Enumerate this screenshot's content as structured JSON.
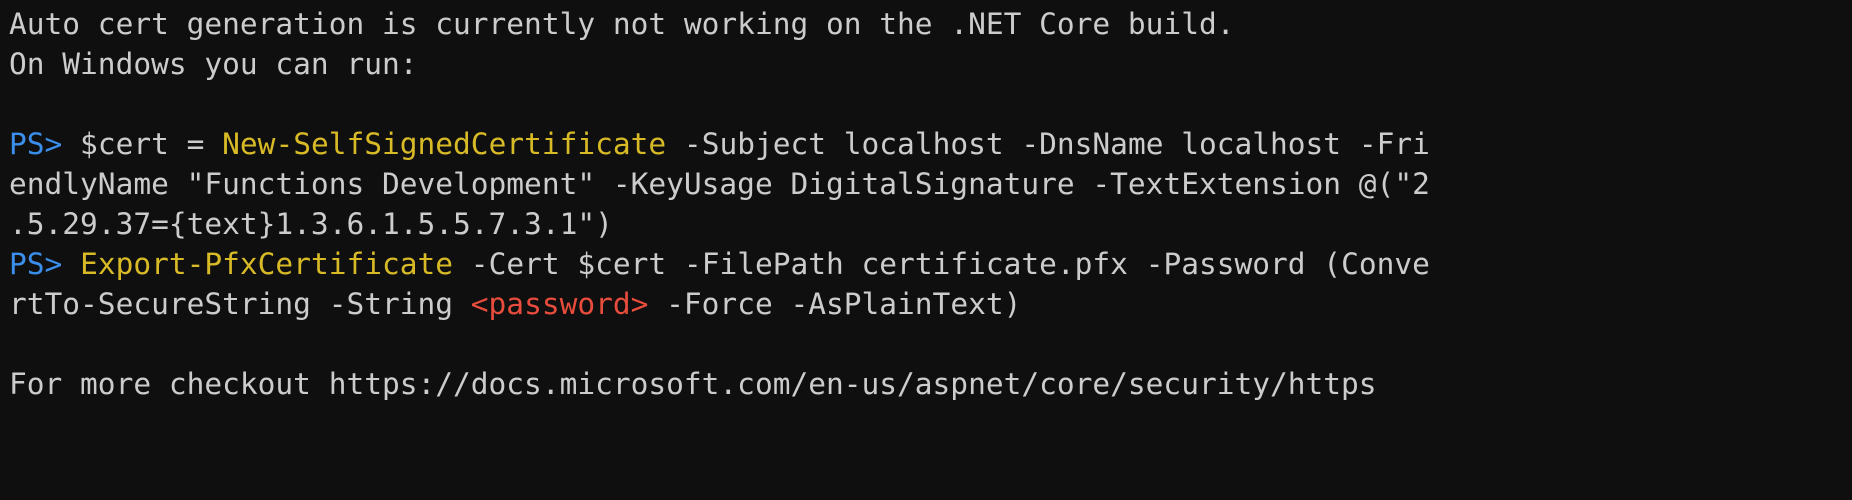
{
  "terminal": {
    "background_color": "#0f0f0f",
    "default_text_color": "#cccccc",
    "prompt_color": "#3b8eea",
    "cmdlet_color": "#d7ba26",
    "placeholder_color": "#e74c3c",
    "lines": [
      {
        "id": "line-1",
        "tokens": [
          {
            "kind": "default",
            "text": "Auto cert generation is currently not working on the .NET Core build."
          }
        ]
      },
      {
        "id": "line-2",
        "tokens": [
          {
            "kind": "default",
            "text": "On Windows you can run:"
          }
        ]
      },
      {
        "id": "line-3",
        "tokens": [
          {
            "kind": "default",
            "text": ""
          }
        ]
      },
      {
        "id": "line-4",
        "tokens": [
          {
            "kind": "prompt",
            "text": "PS>"
          },
          {
            "kind": "default",
            "text": " $cert = "
          },
          {
            "kind": "cmdlet",
            "text": "New-SelfSignedCertificate"
          },
          {
            "kind": "default",
            "text": " -Subject localhost -DnsName localhost -Fri"
          }
        ]
      },
      {
        "id": "line-5",
        "tokens": [
          {
            "kind": "default",
            "text": "endlyName \"Functions Development\" -KeyUsage DigitalSignature -TextExtension @(\"2"
          }
        ]
      },
      {
        "id": "line-6",
        "tokens": [
          {
            "kind": "default",
            "text": ".5.29.37={text}1.3.6.1.5.5.7.3.1\")"
          }
        ]
      },
      {
        "id": "line-7",
        "tokens": [
          {
            "kind": "prompt",
            "text": "PS>"
          },
          {
            "kind": "default",
            "text": " "
          },
          {
            "kind": "cmdlet",
            "text": "Export-PfxCertificate"
          },
          {
            "kind": "default",
            "text": " -Cert $cert -FilePath certificate.pfx -Password (Conve"
          }
        ]
      },
      {
        "id": "line-8",
        "tokens": [
          {
            "kind": "default",
            "text": "rtTo-SecureString -String "
          },
          {
            "kind": "placeholder",
            "text": "<password>"
          },
          {
            "kind": "default",
            "text": " -Force -AsPlainText)"
          }
        ]
      },
      {
        "id": "line-9",
        "tokens": [
          {
            "kind": "default",
            "text": ""
          }
        ]
      },
      {
        "id": "line-10",
        "tokens": [
          {
            "kind": "default",
            "text": "For more checkout https://docs.microsoft.com/en-us/aspnet/core/security/https"
          }
        ]
      }
    ]
  }
}
